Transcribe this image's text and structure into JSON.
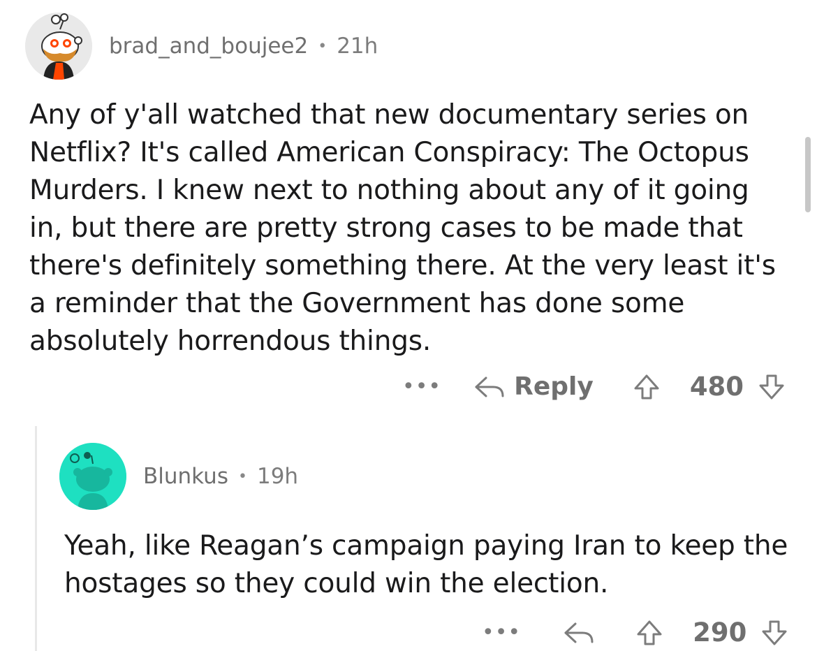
{
  "comments": [
    {
      "username": "brad_and_boujee2",
      "separator": "•",
      "age": "21h",
      "body": "Any of y'all watched that new documentary series on Netflix? It's called American Conspiracy: The Octopus Murders. I knew next to nothing about any of it going in, but there are pretty strong cases to be made that there's definitely something there. At the very least it's a reminder that the Government has done some absolutely horrendous things.",
      "more_label": "•••",
      "reply_label": "Reply",
      "score": "480"
    },
    {
      "username": "Blunkus",
      "separator": "•",
      "age": "19h",
      "body": "Yeah, like Reagan’s campaign paying Iran to keep the hostages so they could win the election.",
      "more_label": "•••",
      "score": "290"
    }
  ],
  "colors": {
    "avatar1_bg": "#e9e9e9",
    "avatar2_bg": "#1ee0c1",
    "meta_text": "#7c7c7c",
    "body_text": "#1a1a1b"
  }
}
